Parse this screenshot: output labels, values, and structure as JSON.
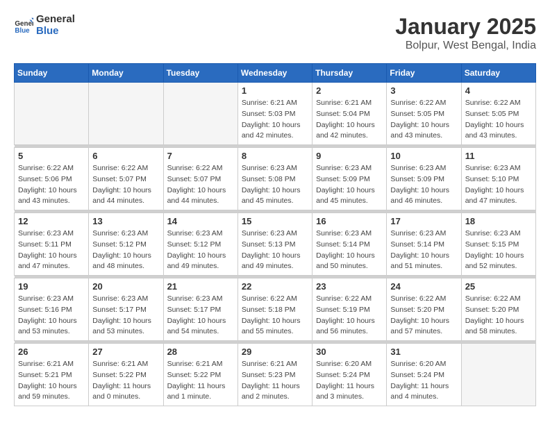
{
  "logo": {
    "text_general": "General",
    "text_blue": "Blue"
  },
  "title": "January 2025",
  "location": "Bolpur, West Bengal, India",
  "days_of_week": [
    "Sunday",
    "Monday",
    "Tuesday",
    "Wednesday",
    "Thursday",
    "Friday",
    "Saturday"
  ],
  "weeks": [
    [
      {
        "day": "",
        "info": ""
      },
      {
        "day": "",
        "info": ""
      },
      {
        "day": "",
        "info": ""
      },
      {
        "day": "1",
        "info": "Sunrise: 6:21 AM\nSunset: 5:03 PM\nDaylight: 10 hours\nand 42 minutes."
      },
      {
        "day": "2",
        "info": "Sunrise: 6:21 AM\nSunset: 5:04 PM\nDaylight: 10 hours\nand 42 minutes."
      },
      {
        "day": "3",
        "info": "Sunrise: 6:22 AM\nSunset: 5:05 PM\nDaylight: 10 hours\nand 43 minutes."
      },
      {
        "day": "4",
        "info": "Sunrise: 6:22 AM\nSunset: 5:05 PM\nDaylight: 10 hours\nand 43 minutes."
      }
    ],
    [
      {
        "day": "5",
        "info": "Sunrise: 6:22 AM\nSunset: 5:06 PM\nDaylight: 10 hours\nand 43 minutes."
      },
      {
        "day": "6",
        "info": "Sunrise: 6:22 AM\nSunset: 5:07 PM\nDaylight: 10 hours\nand 44 minutes."
      },
      {
        "day": "7",
        "info": "Sunrise: 6:22 AM\nSunset: 5:07 PM\nDaylight: 10 hours\nand 44 minutes."
      },
      {
        "day": "8",
        "info": "Sunrise: 6:23 AM\nSunset: 5:08 PM\nDaylight: 10 hours\nand 45 minutes."
      },
      {
        "day": "9",
        "info": "Sunrise: 6:23 AM\nSunset: 5:09 PM\nDaylight: 10 hours\nand 45 minutes."
      },
      {
        "day": "10",
        "info": "Sunrise: 6:23 AM\nSunset: 5:09 PM\nDaylight: 10 hours\nand 46 minutes."
      },
      {
        "day": "11",
        "info": "Sunrise: 6:23 AM\nSunset: 5:10 PM\nDaylight: 10 hours\nand 47 minutes."
      }
    ],
    [
      {
        "day": "12",
        "info": "Sunrise: 6:23 AM\nSunset: 5:11 PM\nDaylight: 10 hours\nand 47 minutes."
      },
      {
        "day": "13",
        "info": "Sunrise: 6:23 AM\nSunset: 5:12 PM\nDaylight: 10 hours\nand 48 minutes."
      },
      {
        "day": "14",
        "info": "Sunrise: 6:23 AM\nSunset: 5:12 PM\nDaylight: 10 hours\nand 49 minutes."
      },
      {
        "day": "15",
        "info": "Sunrise: 6:23 AM\nSunset: 5:13 PM\nDaylight: 10 hours\nand 49 minutes."
      },
      {
        "day": "16",
        "info": "Sunrise: 6:23 AM\nSunset: 5:14 PM\nDaylight: 10 hours\nand 50 minutes."
      },
      {
        "day": "17",
        "info": "Sunrise: 6:23 AM\nSunset: 5:14 PM\nDaylight: 10 hours\nand 51 minutes."
      },
      {
        "day": "18",
        "info": "Sunrise: 6:23 AM\nSunset: 5:15 PM\nDaylight: 10 hours\nand 52 minutes."
      }
    ],
    [
      {
        "day": "19",
        "info": "Sunrise: 6:23 AM\nSunset: 5:16 PM\nDaylight: 10 hours\nand 53 minutes."
      },
      {
        "day": "20",
        "info": "Sunrise: 6:23 AM\nSunset: 5:17 PM\nDaylight: 10 hours\nand 53 minutes."
      },
      {
        "day": "21",
        "info": "Sunrise: 6:23 AM\nSunset: 5:17 PM\nDaylight: 10 hours\nand 54 minutes."
      },
      {
        "day": "22",
        "info": "Sunrise: 6:22 AM\nSunset: 5:18 PM\nDaylight: 10 hours\nand 55 minutes."
      },
      {
        "day": "23",
        "info": "Sunrise: 6:22 AM\nSunset: 5:19 PM\nDaylight: 10 hours\nand 56 minutes."
      },
      {
        "day": "24",
        "info": "Sunrise: 6:22 AM\nSunset: 5:20 PM\nDaylight: 10 hours\nand 57 minutes."
      },
      {
        "day": "25",
        "info": "Sunrise: 6:22 AM\nSunset: 5:20 PM\nDaylight: 10 hours\nand 58 minutes."
      }
    ],
    [
      {
        "day": "26",
        "info": "Sunrise: 6:21 AM\nSunset: 5:21 PM\nDaylight: 10 hours\nand 59 minutes."
      },
      {
        "day": "27",
        "info": "Sunrise: 6:21 AM\nSunset: 5:22 PM\nDaylight: 11 hours\nand 0 minutes."
      },
      {
        "day": "28",
        "info": "Sunrise: 6:21 AM\nSunset: 5:22 PM\nDaylight: 11 hours\nand 1 minute."
      },
      {
        "day": "29",
        "info": "Sunrise: 6:21 AM\nSunset: 5:23 PM\nDaylight: 11 hours\nand 2 minutes."
      },
      {
        "day": "30",
        "info": "Sunrise: 6:20 AM\nSunset: 5:24 PM\nDaylight: 11 hours\nand 3 minutes."
      },
      {
        "day": "31",
        "info": "Sunrise: 6:20 AM\nSunset: 5:24 PM\nDaylight: 11 hours\nand 4 minutes."
      },
      {
        "day": "",
        "info": ""
      }
    ]
  ]
}
